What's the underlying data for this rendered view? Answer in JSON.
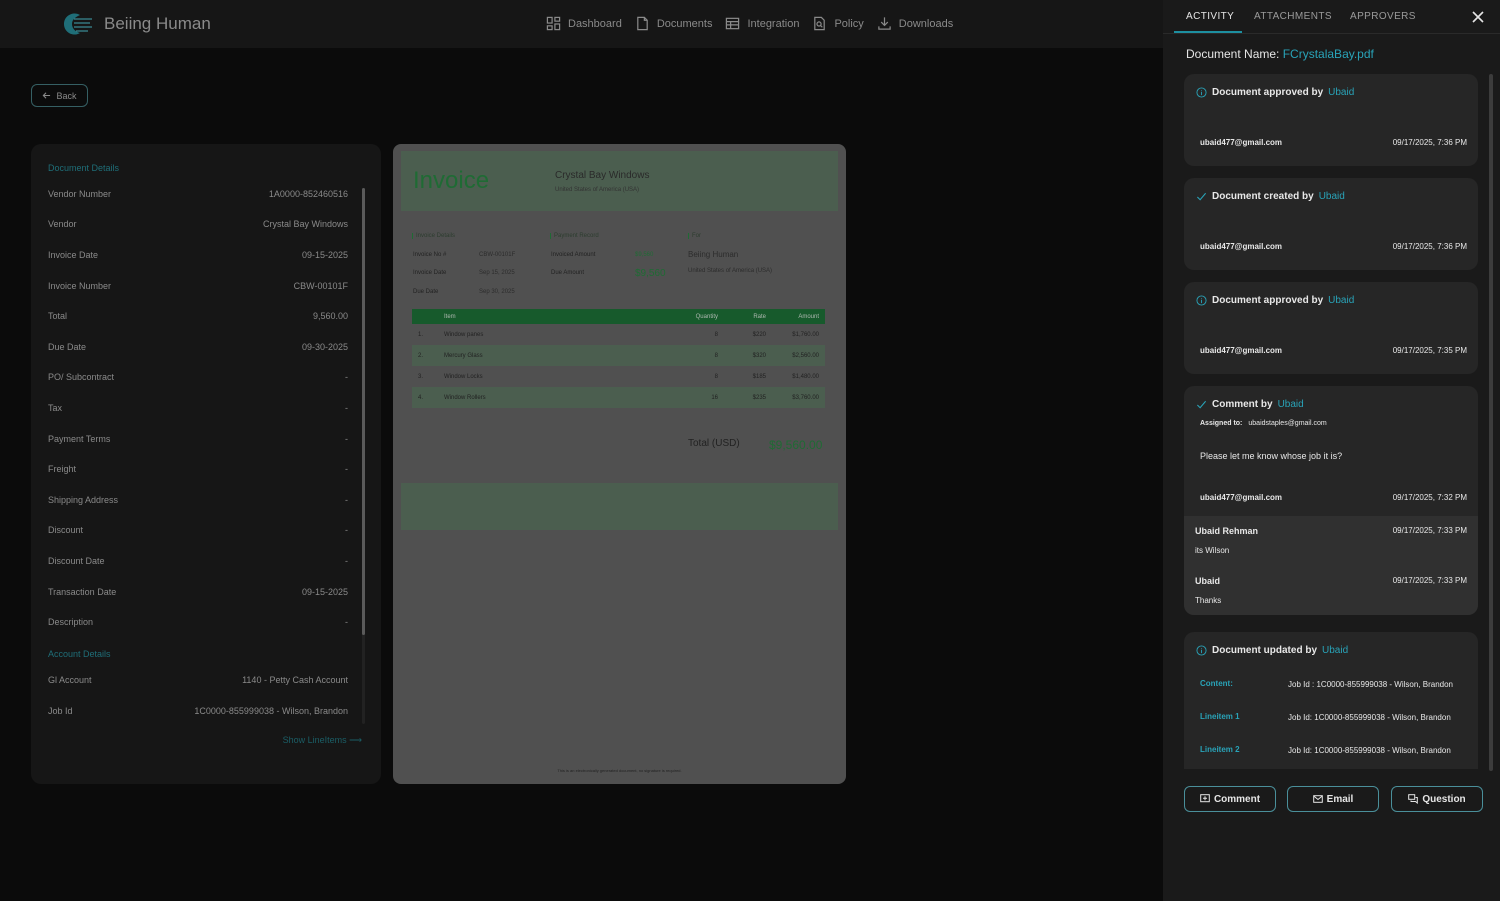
{
  "app": {
    "logo_text": "Beiing Human"
  },
  "nav": [
    {
      "label": "Dashboard",
      "icon": "grid-icon"
    },
    {
      "label": "Documents",
      "icon": "file-icon"
    },
    {
      "label": "Integration",
      "icon": "table-icon"
    },
    {
      "label": "Policy",
      "icon": "search-doc-icon"
    },
    {
      "label": "Downloads",
      "icon": "download-icon"
    }
  ],
  "back_label": "Back",
  "details": {
    "section_title": "Document Details",
    "rows": [
      {
        "label": "Vendor Number",
        "value": "1A0000-852460516"
      },
      {
        "label": "Vendor",
        "value": "Crystal Bay Windows"
      },
      {
        "label": "Invoice Date",
        "value": "09-15-2025"
      },
      {
        "label": "Invoice Number",
        "value": "CBW-00101F"
      },
      {
        "label": "Total",
        "value": "9,560.00"
      },
      {
        "label": "Due Date",
        "value": "09-30-2025"
      },
      {
        "label": "PO/ Subcontract",
        "value": "-"
      },
      {
        "label": "Tax",
        "value": "-"
      },
      {
        "label": "Payment Terms",
        "value": "-"
      },
      {
        "label": "Freight",
        "value": "-"
      },
      {
        "label": "Shipping Address",
        "value": "-"
      },
      {
        "label": "Discount",
        "value": "-"
      },
      {
        "label": "Discount Date",
        "value": "-"
      },
      {
        "label": "Transaction Date",
        "value": "09-15-2025"
      },
      {
        "label": "Description",
        "value": "-"
      }
    ],
    "account_title": "Account Details",
    "account_rows": [
      {
        "label": "Gl Account",
        "value": "1140 - Petty Cash Account"
      },
      {
        "label": "Job Id",
        "value": "1C0000-855999038 - Wilson, Brandon"
      }
    ],
    "show_lineitems": "Show LineItems ⟶"
  },
  "invoice": {
    "title": "Invoice",
    "company": "Crystal Bay Windows",
    "country": "United States of America (USA)",
    "sec_details": "Invoice Details",
    "sec_payment": "Payment Record",
    "sec_for": "For",
    "invoice_no_label": "Invoice No #",
    "invoice_no": "CBW-00101F",
    "invoice_date_label": "Invoice Date",
    "invoice_date": "Sep 15, 2025",
    "due_date_label": "Due Date",
    "due_date": "Sep 30, 2025",
    "invoiced_amount_label": "Invoiced Amount",
    "invoiced_amount": "$9,560",
    "due_amount_label": "Due Amount",
    "due_amount": "$9,560",
    "for_name": "Beiing Human",
    "for_country": "United States of America (USA)",
    "headers": [
      "Item",
      "Quantity",
      "Rate",
      "Amount"
    ],
    "items": [
      {
        "n": "1.",
        "item": "Window panes",
        "qty": "8",
        "rate": "$220",
        "amount": "$1,760.00"
      },
      {
        "n": "2.",
        "item": "Mercury Glass",
        "qty": "8",
        "rate": "$320",
        "amount": "$2,560.00"
      },
      {
        "n": "3.",
        "item": "Window Locks",
        "qty": "8",
        "rate": "$185",
        "amount": "$1,480.00"
      },
      {
        "n": "4.",
        "item": "Window Rollers",
        "qty": "16",
        "rate": "$235",
        "amount": "$3,760.00"
      }
    ],
    "total_label": "Total (USD)",
    "total_value": "$9,560.00",
    "note": "This is an electronically generated document, no signature is required."
  },
  "side": {
    "tabs": [
      "ACTIVITY",
      "ATTACHMENTS",
      "APPROVERS"
    ],
    "doc_name_label": "Document Name:",
    "doc_name": "FCrystalaBay.pdf",
    "cards": [
      {
        "title": "Document approved by",
        "by": "Ubaid",
        "email": "ubaid477@gmail.com",
        "time": "09/17/2025, 7:36 PM"
      },
      {
        "title": "Document created by",
        "by": "Ubaid",
        "email": "ubaid477@gmail.com",
        "time": "09/17/2025, 7:36 PM"
      },
      {
        "title": "Document approved by",
        "by": "Ubaid",
        "email": "ubaid477@gmail.com",
        "time": "09/17/2025, 7:35 PM"
      }
    ],
    "comment": {
      "title": "Comment by",
      "by": "Ubaid",
      "assigned_label": "Assigned to:",
      "assigned_to": "ubaidstaples@gmail.com",
      "text": "Please let me know whose job it is?",
      "email": "ubaid477@gmail.com",
      "time": "09/17/2025, 7:32 PM",
      "replies": [
        {
          "name": "Ubaid Rehman",
          "time": "09/17/2025, 7:33 PM",
          "text": "its Wilson"
        },
        {
          "name": "Ubaid",
          "time": "09/17/2025, 7:33 PM",
          "text": "Thanks"
        }
      ]
    },
    "update": {
      "title": "Document updated by",
      "by": "Ubaid",
      "rows": [
        {
          "label": "Content:",
          "value": "Job Id : 1C0000-855999038 - Wilson, Brandon"
        },
        {
          "label": "Lineitem 1",
          "value": "Job Id: 1C0000-855999038 - Wilson, Brandon"
        },
        {
          "label": "Lineitem 2",
          "value": "Job Id: 1C0000-855999038 - Wilson, Brandon"
        }
      ]
    },
    "buttons": [
      "Comment",
      "Email",
      "Question"
    ]
  }
}
